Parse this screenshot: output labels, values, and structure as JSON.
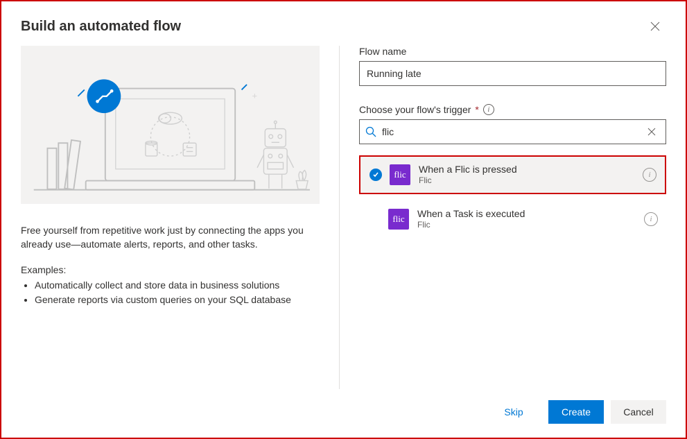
{
  "header": {
    "title": "Build an automated flow"
  },
  "left": {
    "description": "Free yourself from repetitive work just by connecting the apps you already use—automate alerts, reports, and other tasks.",
    "examples_label": "Examples:",
    "examples": [
      "Automatically collect and store data in business solutions",
      "Generate reports via custom queries on your SQL database"
    ]
  },
  "right": {
    "flow_name_label": "Flow name",
    "flow_name_value": "Running late",
    "trigger_label": "Choose your flow's trigger",
    "search_value": "flic",
    "triggers": [
      {
        "title": "When a Flic is pressed",
        "connector": "Flic",
        "icon_text": "flic",
        "selected": true
      },
      {
        "title": "When a Task is executed",
        "connector": "Flic",
        "icon_text": "flic",
        "selected": false
      }
    ]
  },
  "footer": {
    "skip": "Skip",
    "create": "Create",
    "cancel": "Cancel"
  }
}
